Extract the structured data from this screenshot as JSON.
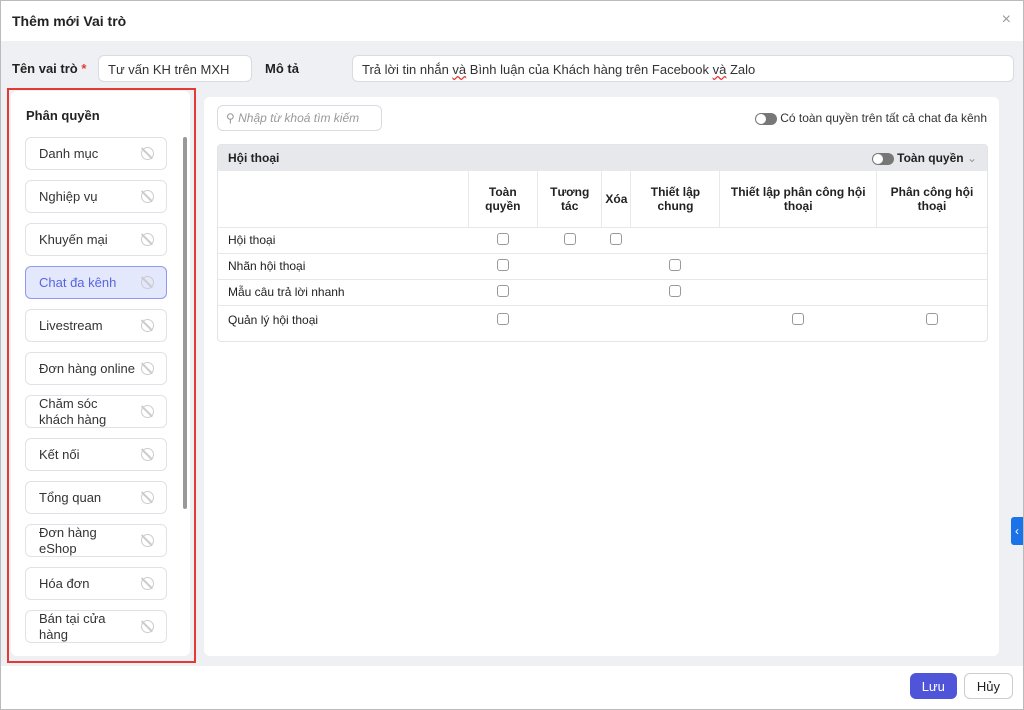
{
  "title": "Thêm mới Vai trò",
  "close": "×",
  "form": {
    "name_label": "Tên vai trò",
    "required": "*",
    "name_value": "Tư vấn KH trên MXH",
    "desc_label": "Mô tả",
    "desc_parts": [
      "Trả lời tin nhắn ",
      "và",
      " Bình luận của Khách hàng trên Facebook ",
      "và",
      " Zalo"
    ]
  },
  "sidebar": {
    "title": "Phân quyền",
    "items": [
      "Danh mục",
      "Nghiệp vụ",
      "Khuyến mại",
      "Chat đa kênh",
      "Livestream",
      "Đơn hàng online",
      "Chăm sóc khách hàng",
      "Kết nối",
      "Tổng quan",
      "Đơn hàng eShop",
      "Hóa đơn",
      "Bán tại cửa hàng"
    ],
    "active": 3
  },
  "main": {
    "search_placeholder": "Nhập từ khoá tìm kiếm",
    "all_toggle": "Có toàn quyền trên tất cả chat đa kênh",
    "section": {
      "title": "Hội thoại",
      "toggle": "Toàn quyền",
      "chevron": "⌄",
      "columns": [
        "Toàn quyền",
        "Tương tác",
        "Xóa",
        "Thiết lập chung",
        "Thiết lập phân công hội thoại",
        "Phân công hội thoại"
      ],
      "rows": [
        {
          "label": "Hội thoại",
          "checks": [
            1,
            1,
            1,
            0,
            0,
            0
          ]
        },
        {
          "label": "Nhãn hội thoại",
          "checks": [
            1,
            0,
            0,
            1,
            0,
            0
          ]
        },
        {
          "label": "Mẫu câu trả lời nhanh",
          "checks": [
            1,
            0,
            0,
            1,
            0,
            0
          ]
        },
        {
          "label": "Quản lý hội thoại",
          "checks": [
            1,
            0,
            0,
            0,
            1,
            1
          ]
        }
      ]
    }
  },
  "footer": {
    "save": "Lưu",
    "cancel": "Hủy"
  }
}
